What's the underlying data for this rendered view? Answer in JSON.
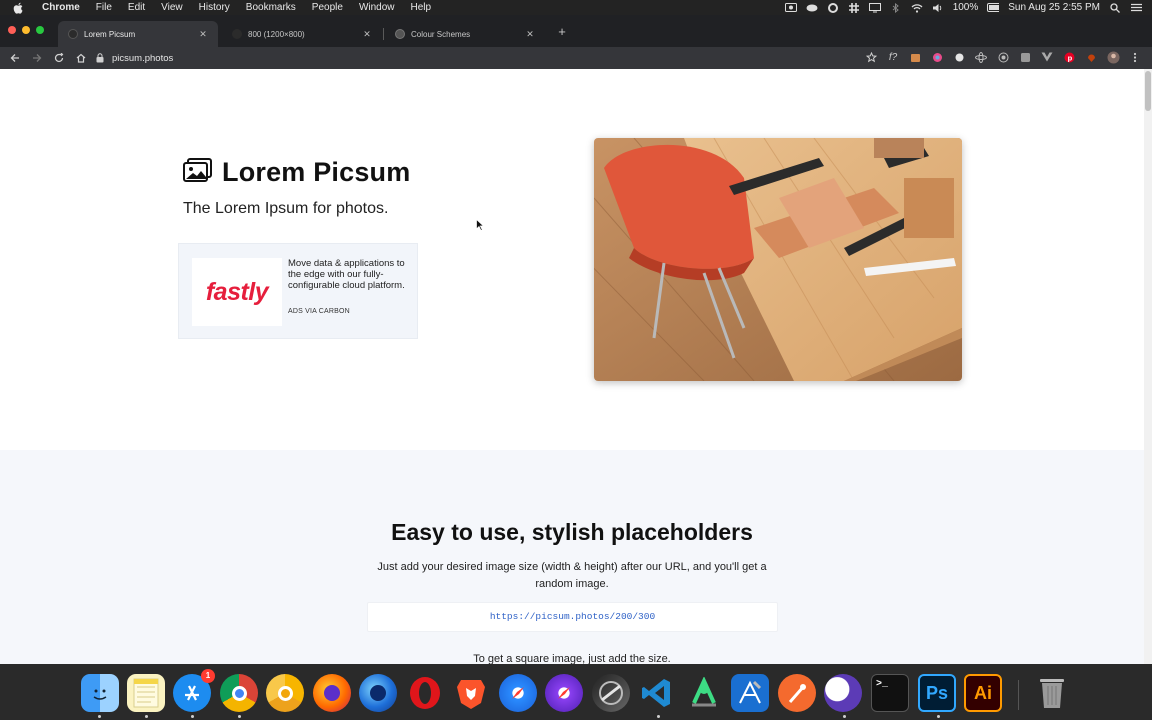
{
  "menubar": {
    "app_name": "Chrome",
    "items": [
      "File",
      "Edit",
      "View",
      "History",
      "Bookmarks",
      "People",
      "Window",
      "Help"
    ],
    "battery": "100%",
    "datetime": "Sun Aug 25  2:55 PM"
  },
  "tabs": [
    {
      "title": "Lorem Picsum",
      "active": true
    },
    {
      "title": "800 (1200×800)",
      "active": false
    },
    {
      "title": "Colour Schemes",
      "active": false
    }
  ],
  "toolbar": {
    "url": "picsum.photos",
    "extensions": [
      "star-icon",
      "function-icon",
      "extension-icon",
      "color-picker-icon",
      "record-icon",
      "react-icon",
      "target-icon",
      "extension-icon",
      "vue-icon",
      "pinterest-icon",
      "extension-icon",
      "profile-avatar",
      "more-icon"
    ]
  },
  "hero": {
    "title": "Lorem Picsum",
    "subtitle": "The Lorem Ipsum for photos."
  },
  "ad": {
    "logo_text": "fastly",
    "text": "Move data & applications to the edge with our fully-configurable cloud platform.",
    "via": "ADS VIA CARBON"
  },
  "section2": {
    "title": "Easy to use, stylish placeholders",
    "description": "Just add your desired image size (width & height) after our URL, and you'll get a random image.",
    "code": "https://picsum.photos/200/300",
    "next_line": "To get a square image, just add the size."
  },
  "dock": {
    "apps": [
      "Finder",
      "Notes",
      "App Store",
      "Chrome",
      "Chrome Canary",
      "Firefox",
      "Firefox Developer Edition",
      "Opera",
      "Brave",
      "Safari",
      "Safari Technology Preview",
      "Final Cut",
      "Visual Studio Code",
      "Android Studio",
      "Xcode Instruments",
      "Paw",
      "Eclipse",
      "Terminal",
      "Photoshop",
      "Illustrator",
      "Trash"
    ],
    "app_store_badge": "1",
    "photoshop_label": "Ps",
    "illustrator_label": "Ai"
  },
  "colors": {
    "page_bg": "#ffffff",
    "section_bg": "#f5f7fb",
    "code_color": "#2f62c7",
    "fastly_red": "#e61e3c"
  }
}
